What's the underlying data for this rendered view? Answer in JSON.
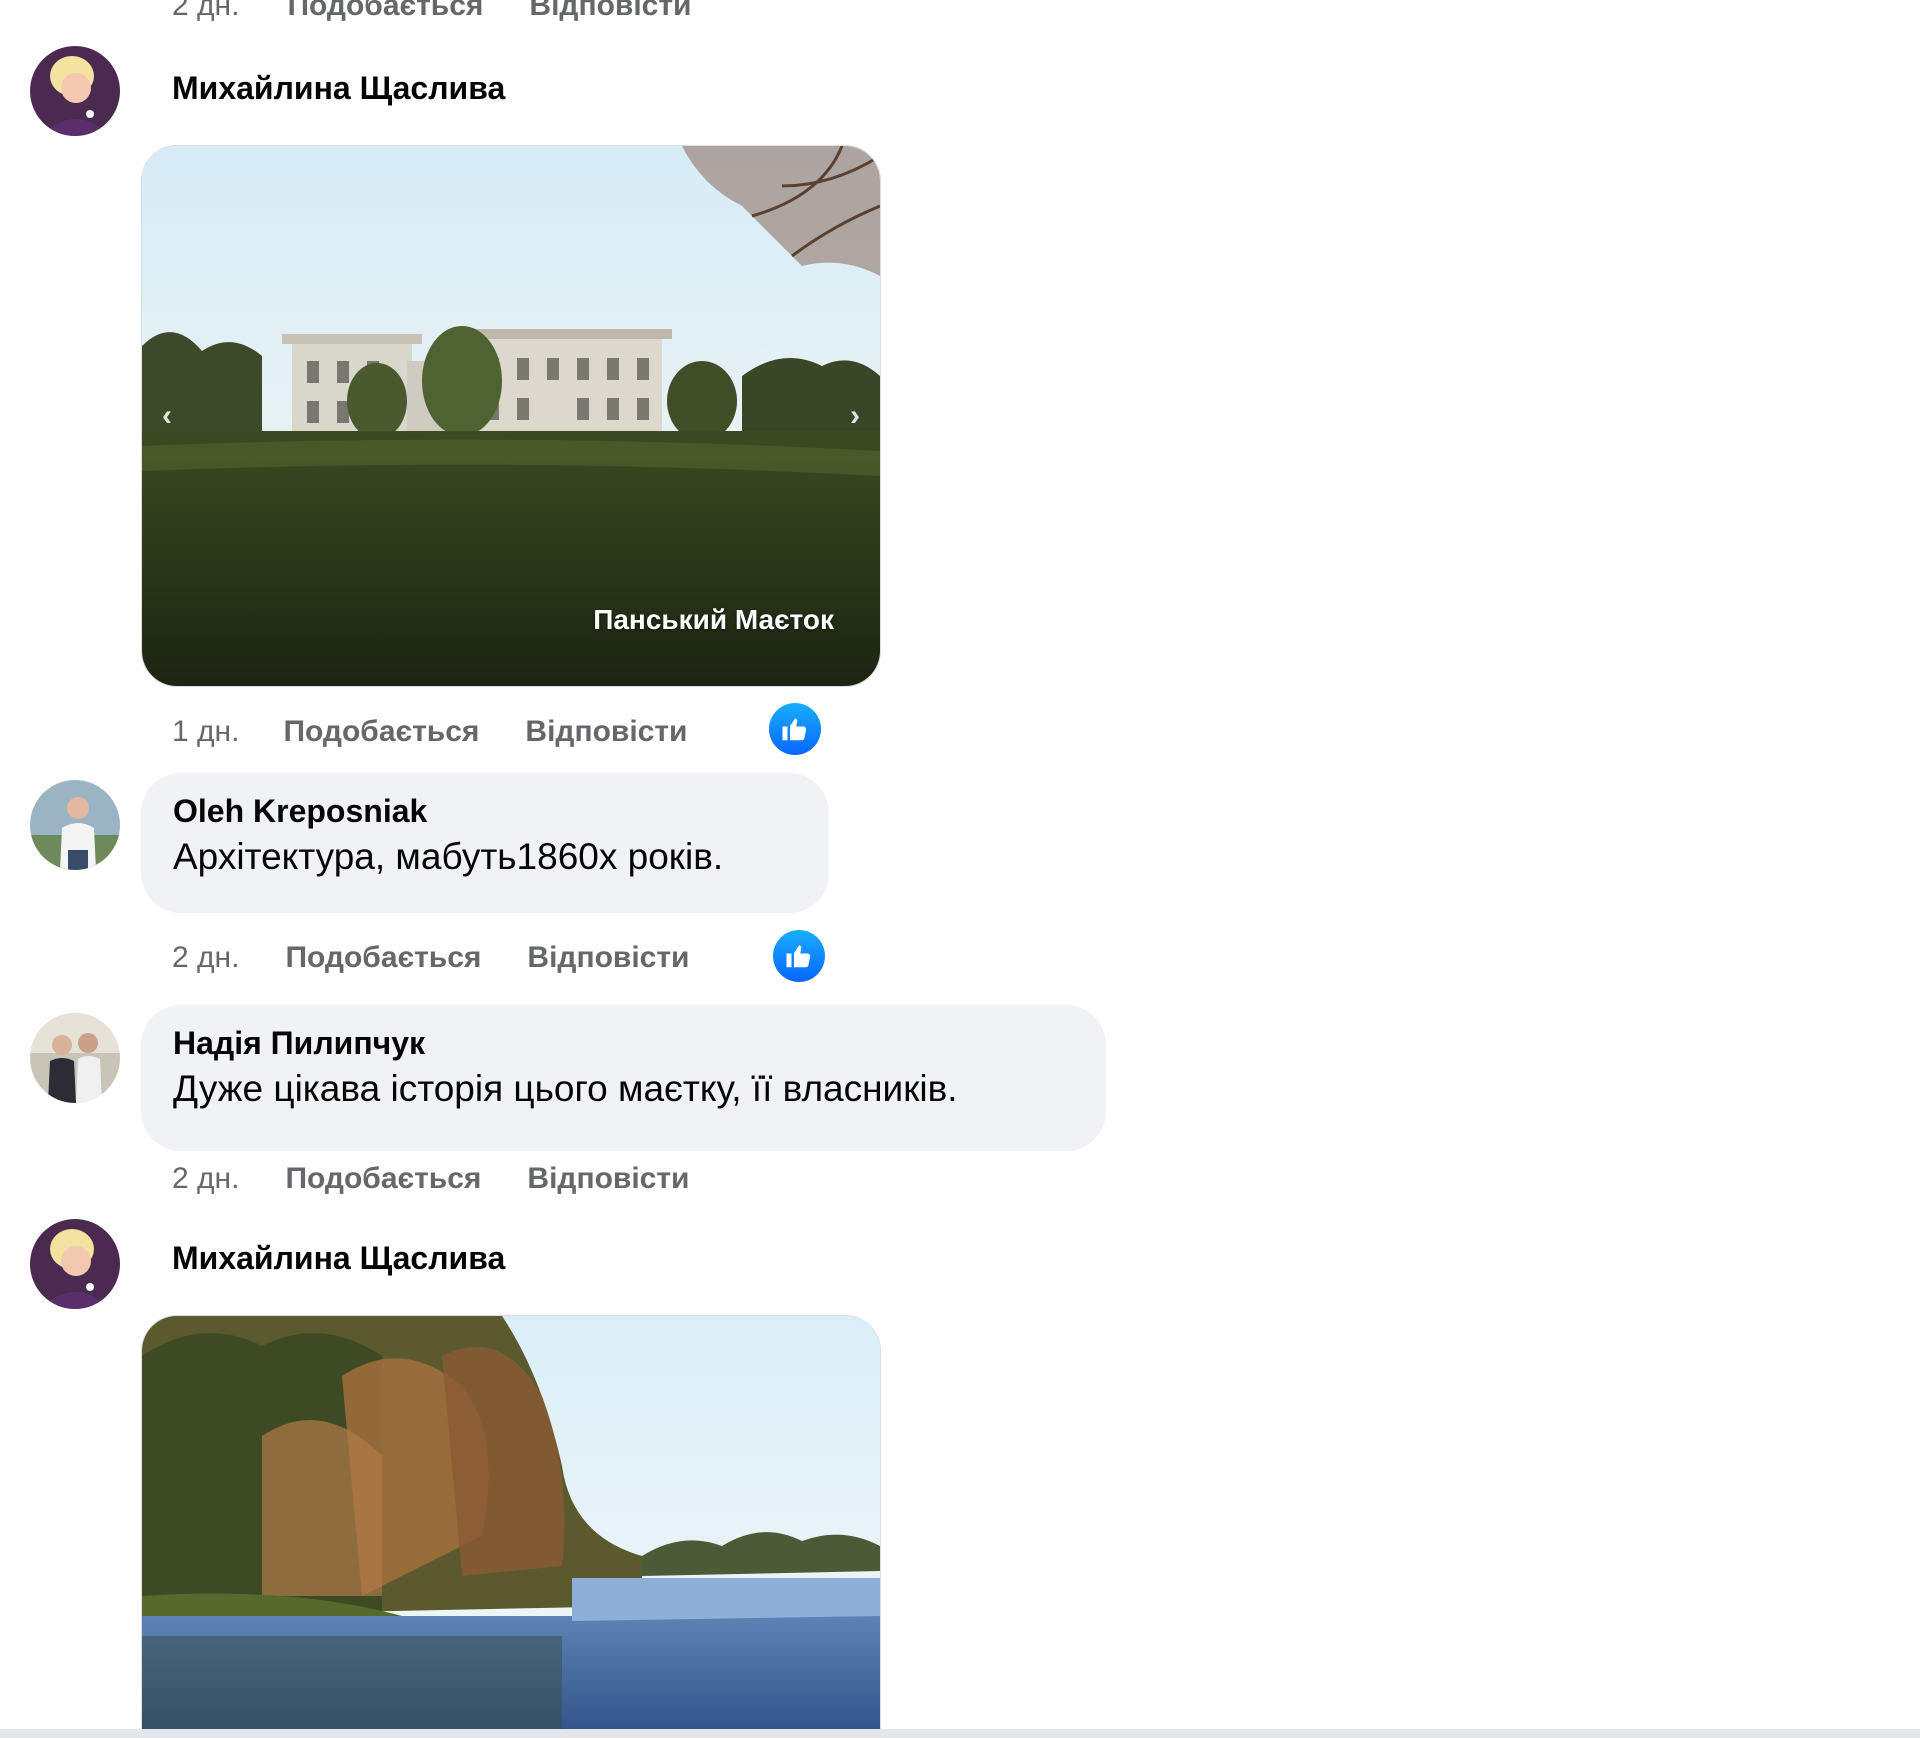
{
  "colors": {
    "secondary_text": "#65676b",
    "bubble_bg": "#f0f2f5",
    "like_blue": "#0866ff"
  },
  "top_actions": {
    "time": "2 дн.",
    "like": "Подобається",
    "reply": "Відповісти"
  },
  "comments": [
    {
      "author": "Михайлина Щаслива",
      "avatar_icon": "user-avatar-icon",
      "photo": {
        "caption": "Панський Маєток",
        "prev_icon": "chevron-left-icon",
        "next_icon": "chevron-right-icon"
      },
      "time": "1 дн.",
      "like": "Подобається",
      "reply": "Відповісти",
      "reaction_icon": "thumbs-up-icon"
    },
    {
      "author": "Oleh Kreposniak",
      "avatar_icon": "user-avatar-icon",
      "text": "Архітектура, мабуть1860х років.",
      "time": "2 дн.",
      "like": "Подобається",
      "reply": "Відповісти",
      "reaction_icon": "thumbs-up-icon"
    },
    {
      "author": "Надія Пилипчук",
      "avatar_icon": "user-avatar-icon",
      "text": "Дуже цікава історія цього маєтку, її власників.",
      "time": "2 дн.",
      "like": "Подобається",
      "reply": "Відповісти"
    },
    {
      "author": "Михайлина Щаслива",
      "avatar_icon": "user-avatar-icon"
    }
  ]
}
